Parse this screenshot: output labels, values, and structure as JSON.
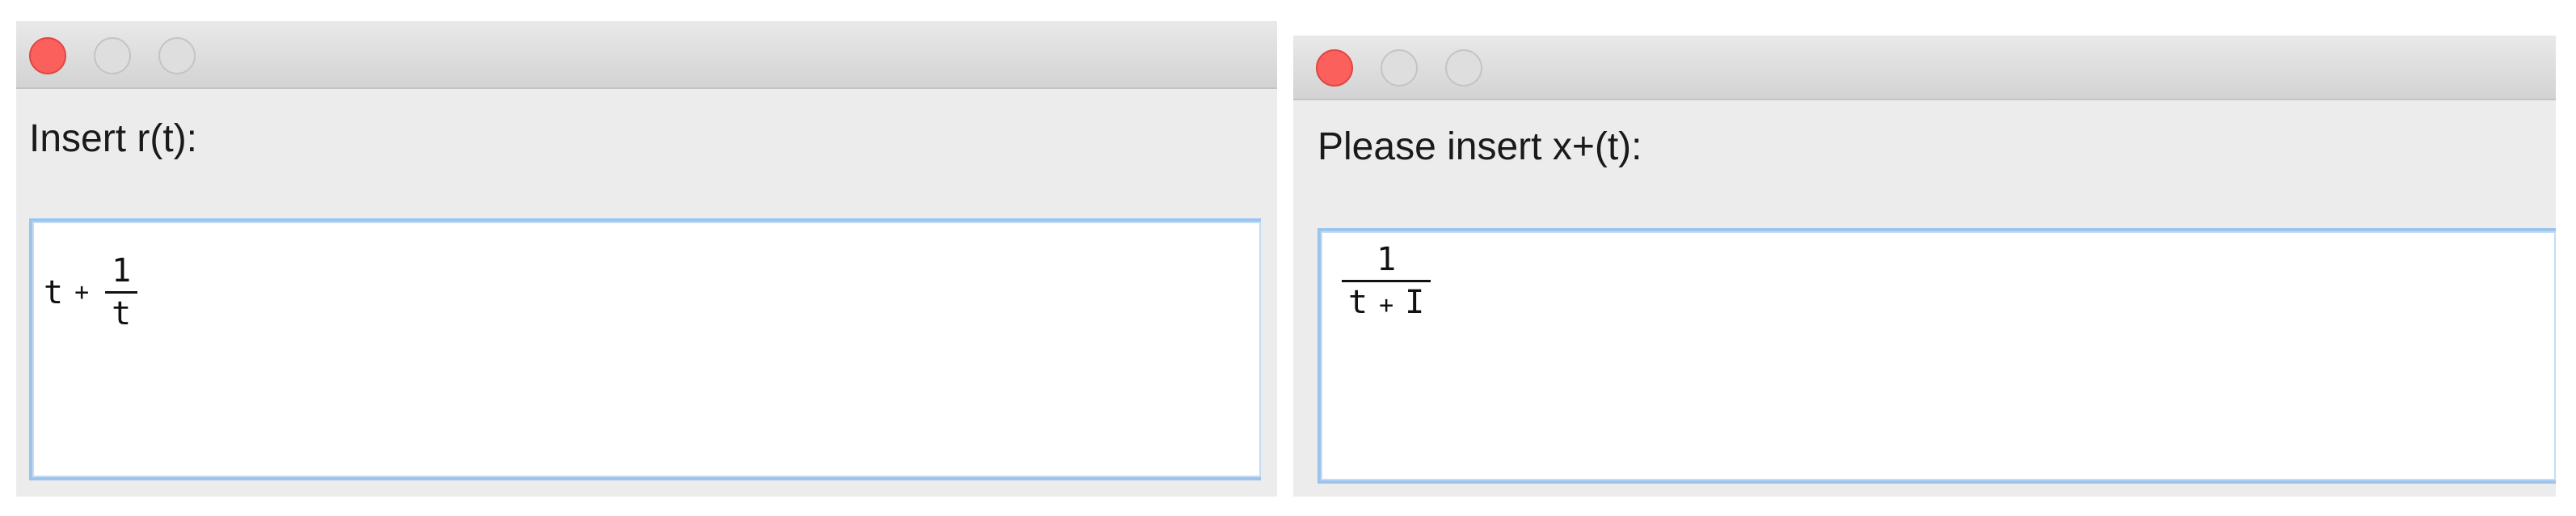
{
  "left_dialog": {
    "prompt": "Insert r(t):",
    "expression": {
      "lead_term": "t",
      "operator": "+",
      "fraction": {
        "numerator": "1",
        "denominator": "t"
      }
    }
  },
  "right_dialog": {
    "prompt": "Please insert x+(t):",
    "expression": {
      "fraction": {
        "numerator": "1",
        "denominator": {
          "term1": "t",
          "operator": "+",
          "term2": "I"
        }
      }
    }
  },
  "colors": {
    "close_button": "#fc605c",
    "inactive_button": "#dedede",
    "focus_ring": "#9cc4ec",
    "window_bg": "#ececec"
  },
  "icons": [
    "close-icon",
    "minimize-icon",
    "zoom-icon"
  ]
}
